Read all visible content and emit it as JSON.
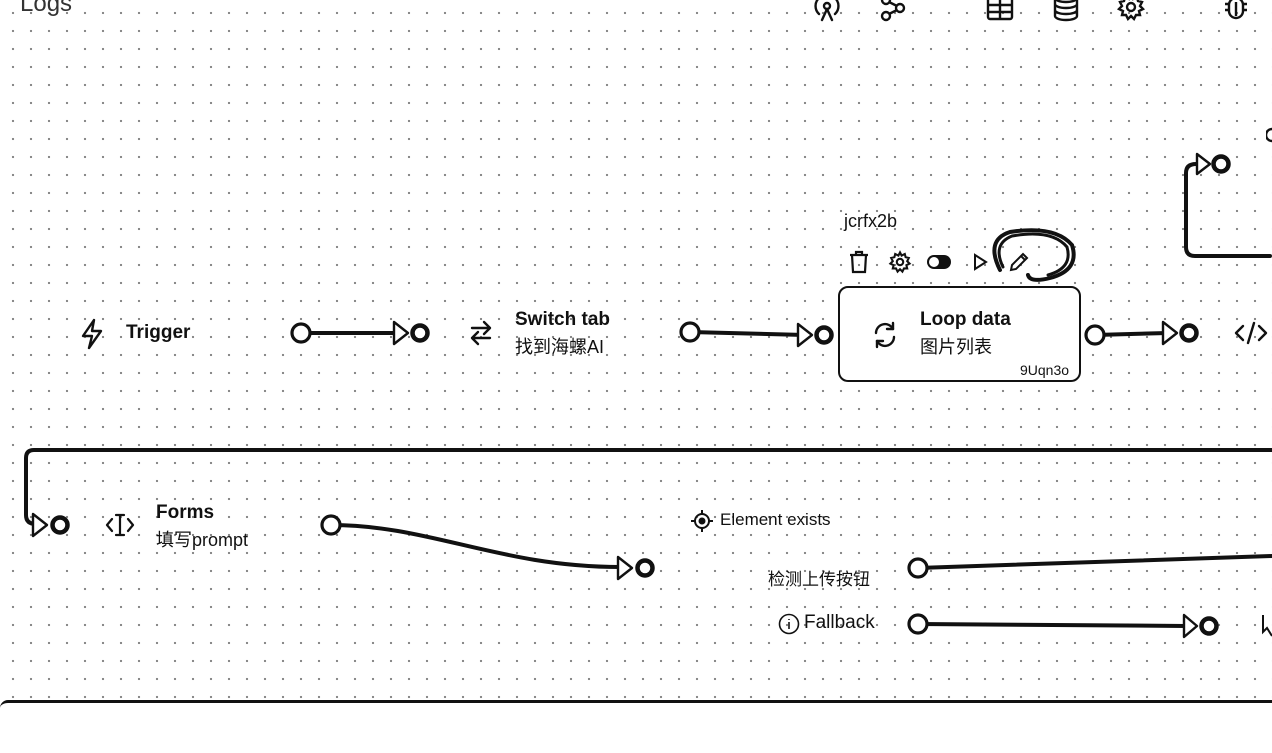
{
  "toolbar": {
    "title": "Logs",
    "icons": [
      "broadcast-icon",
      "share-icon",
      "table-icon",
      "database-icon",
      "settings-icon",
      "bug-icon"
    ]
  },
  "nodes": {
    "trigger": {
      "label": "Trigger",
      "icon": "lightning-icon"
    },
    "switch_tab": {
      "label": "Switch tab",
      "sub": "找到海螺AI",
      "icon": "swap-arrows-icon"
    },
    "loop_data": {
      "label": "Loop data",
      "sub": "图片列表",
      "id_above": "jcrfx2b",
      "id_below": "9Uqn3o",
      "icon": "refresh-icon",
      "hover_actions": [
        "delete-icon",
        "settings-icon",
        "toggle-icon",
        "play-icon",
        "edit-icon"
      ]
    },
    "code": {
      "icon": "code-icon"
    },
    "forms": {
      "label": "Forms",
      "sub": "填写prompt",
      "icon": "text-cursor-icon"
    },
    "element_exists": {
      "label": "Element exists",
      "condition": "检测上传按钮",
      "fallback": "Fallback",
      "icon": "target-icon"
    }
  }
}
